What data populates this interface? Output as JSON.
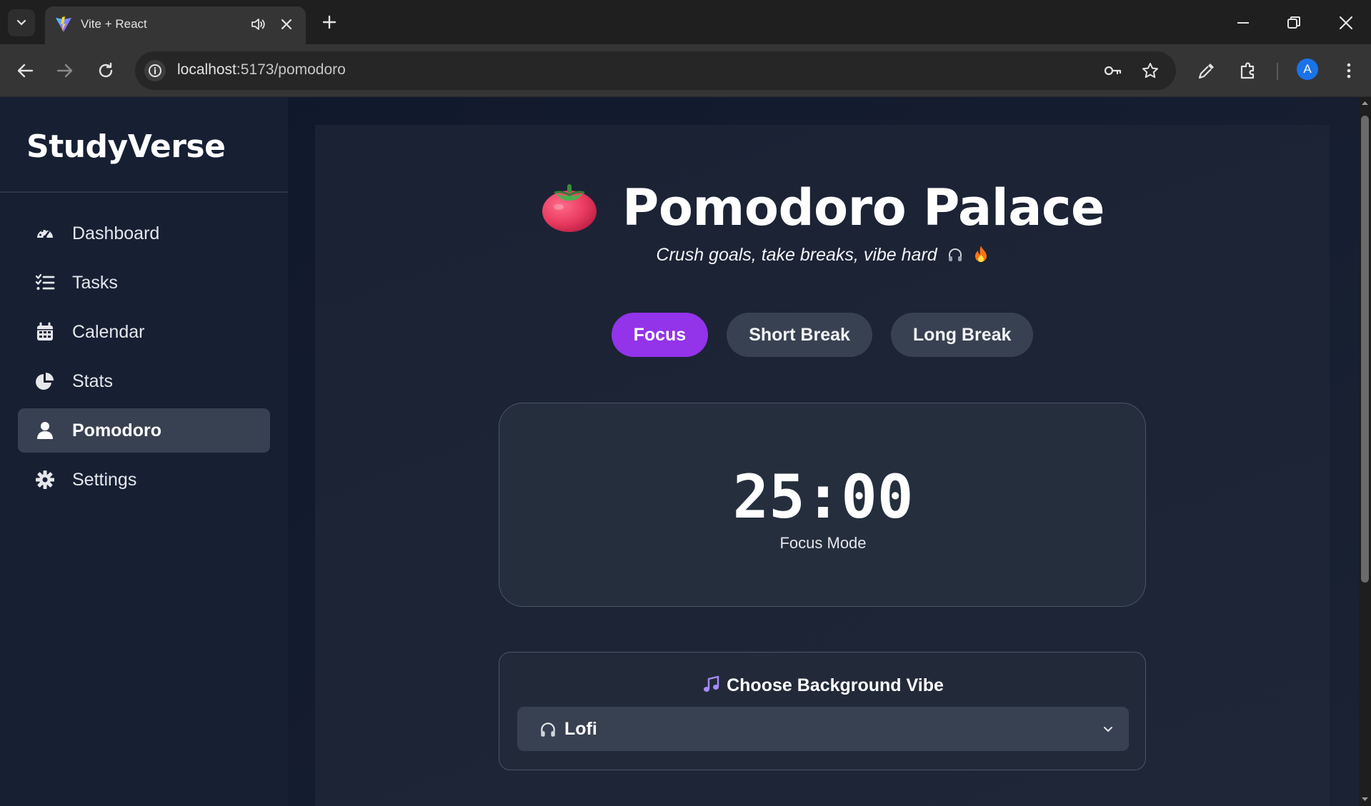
{
  "browser": {
    "tab_title": "Vite + React",
    "url_host": "localhost",
    "url_path": ":5173/pomodoro",
    "profile_initial": "A"
  },
  "sidebar": {
    "brand": "StudyVerse",
    "items": [
      {
        "label": "Dashboard",
        "icon": "gauge-icon",
        "active": false
      },
      {
        "label": "Tasks",
        "icon": "list-check-icon",
        "active": false
      },
      {
        "label": "Calendar",
        "icon": "calendar-icon",
        "active": false
      },
      {
        "label": "Stats",
        "icon": "pie-chart-icon",
        "active": false
      },
      {
        "label": "Pomodoro",
        "icon": "user-icon",
        "active": true
      },
      {
        "label": "Settings",
        "icon": "gear-icon",
        "active": false
      }
    ]
  },
  "main": {
    "title": "Pomodoro Palace",
    "subtitle": "Crush goals, take breaks, vibe hard",
    "modes": [
      {
        "label": "Focus",
        "active": true
      },
      {
        "label": "Short Break",
        "active": false
      },
      {
        "label": "Long Break",
        "active": false
      }
    ],
    "timer": "25:00",
    "timer_label": "Focus Mode",
    "vibe_title": "Choose Background Vibe",
    "vibe_selected": "Lofi"
  },
  "colors": {
    "accent": "#9333ea",
    "app_bg": "#0f172a",
    "sidebar_bg": "#172033",
    "card_bg": "#252e3d"
  }
}
